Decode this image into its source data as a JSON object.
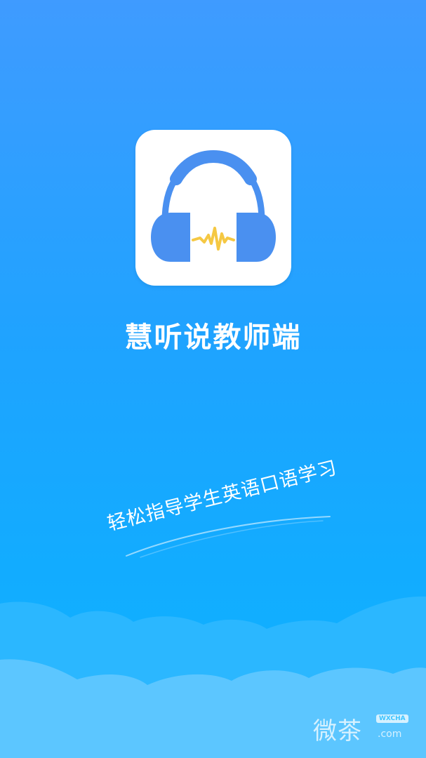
{
  "splash": {
    "app_name": "慧听说教师端",
    "tagline": "轻松指导学生英语口语学习",
    "icon": "headphones-icon"
  },
  "watermark": {
    "text": "微茶",
    "badge": "WXCHA",
    "domain": ".com"
  },
  "colors": {
    "background_top": "#3f9bff",
    "background_bottom": "#0fb4ff",
    "headphone_blue": "#4a90f0",
    "soundwave_yellow": "#f5c843",
    "cloud_light": "#5cc6ff"
  }
}
